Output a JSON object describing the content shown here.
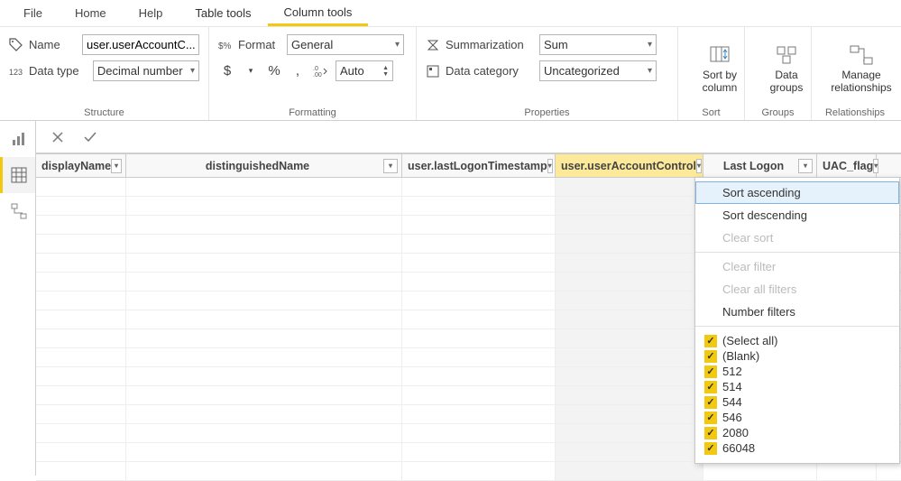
{
  "tabs": {
    "file": "File",
    "home": "Home",
    "help": "Help",
    "table": "Table tools",
    "column": "Column tools"
  },
  "ribbon": {
    "structure": {
      "name_label": "Name",
      "name_value": "user.userAccountC...",
      "datatype_label": "Data type",
      "datatype_value": "Decimal number",
      "group": "Structure"
    },
    "formatting": {
      "format_label": "Format",
      "format_value": "General",
      "auto_value": "Auto",
      "group": "Formatting"
    },
    "properties": {
      "summarization_label": "Summarization",
      "summarization_value": "Sum",
      "category_label": "Data category",
      "category_value": "Uncategorized",
      "group": "Properties"
    },
    "sort": {
      "btn": "Sort by\ncolumn",
      "group": "Sort"
    },
    "groups": {
      "btn": "Data\ngroups",
      "group": "Groups"
    },
    "relationships": {
      "btn": "Manage\nrelationships",
      "group": "Relationships"
    }
  },
  "columns": {
    "c0": "displayName",
    "c1": "distinguishedName",
    "c2": "user.lastLogonTimestamp",
    "c3": "user.userAccountControl",
    "c4": "Last Logon",
    "c5": "UAC_flag"
  },
  "menu": {
    "sort_asc": "Sort ascending",
    "sort_desc": "Sort descending",
    "clear_sort": "Clear sort",
    "clear_filter": "Clear filter",
    "clear_all": "Clear all filters",
    "number_filters": "Number filters",
    "select_all": "(Select all)",
    "blank": "(Blank)",
    "v512": "512",
    "v514": "514",
    "v544": "544",
    "v546": "546",
    "v2080": "2080",
    "v66048": "66048"
  }
}
